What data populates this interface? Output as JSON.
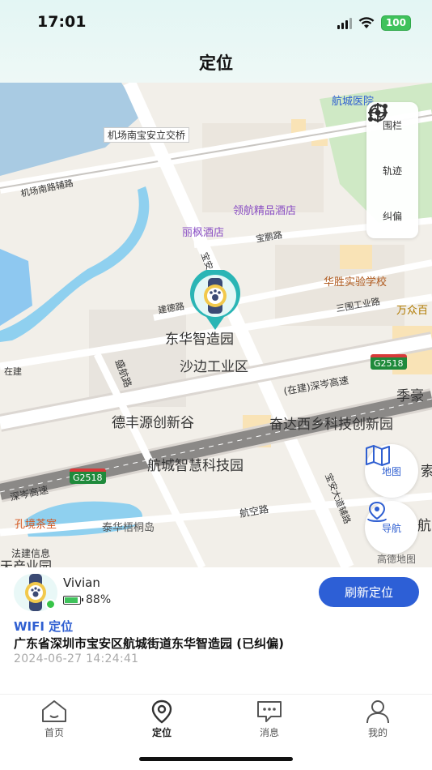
{
  "status_bar": {
    "time": "17:01",
    "battery": "100"
  },
  "header": {
    "title": "定位"
  },
  "map": {
    "labels": {
      "hospital": "航城医院",
      "interchange": "机场南宝安立交桥",
      "road_jichangnan": "机场南路辅路",
      "lingwang_store": "领航精品酒店",
      "lifeng_hotel": "丽枫酒店",
      "baopeng_road": "宝鹏路",
      "huasheng_school": "华胜实验学校",
      "sanwei_road": "三围工业路",
      "wanzhong": "万众百",
      "jiande_road": "建德路",
      "baoan_road": "宝安",
      "donghua": "东华智造园",
      "shabian": "沙边工业区",
      "zaijian": "在建",
      "jishun_road": "盛航路",
      "g2518_a": "G2518",
      "g2518_b": "G2518",
      "highway_zaijian": "(在建)深岑高速",
      "jihao": "季豪",
      "defengyuan": "德丰源创新谷",
      "fenda": "奋达西乡科技创新园",
      "hangcheng_park": "航城智慧科技园",
      "shencen_left": "深岑高速",
      "suo": "索",
      "kongjing_tea": "孔境茶室",
      "taihua": "泰华梧桐岛",
      "hangkong_road": "航空路",
      "baoan_avenue": "宝安大道辅路",
      "hang": "航",
      "fazhi": "法建信息",
      "chanye": "天产业园",
      "gaode": "高德地图"
    },
    "tools": [
      {
        "label": "围栏",
        "icon": "fence-icon"
      },
      {
        "label": "轨迹",
        "icon": "track-icon"
      },
      {
        "label": "纠偏",
        "icon": "correction-icon"
      }
    ],
    "map_button": {
      "label": "地图",
      "icon": "map-icon"
    },
    "nav_button": {
      "label": "导航",
      "icon": "navigation-icon"
    }
  },
  "device": {
    "name": "Vivian",
    "battery_percent": "88%",
    "battery_level": 0.88,
    "refresh_label": "刷新定位",
    "location_type": "WIFI 定位",
    "address": "广东省深圳市宝安区航城街道东华智造园 (已纠偏)",
    "timestamp": "2024-06-27 14:24:41"
  },
  "tabs": [
    {
      "label": "首页",
      "icon": "home-icon",
      "active": false
    },
    {
      "label": "定位",
      "icon": "location-icon",
      "active": true
    },
    {
      "label": "消息",
      "icon": "message-icon",
      "active": false
    },
    {
      "label": "我的",
      "icon": "profile-icon",
      "active": false
    }
  ],
  "colors": {
    "accent": "#2d5fd6",
    "marker": "#2ab5b5",
    "online": "#38c448",
    "header_bg": "#e3f6f4"
  }
}
